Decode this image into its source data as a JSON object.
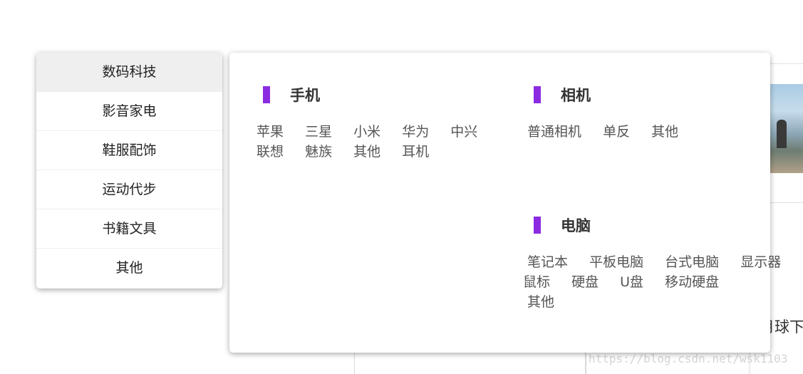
{
  "categories": [
    {
      "label": "数码科技",
      "active": true
    },
    {
      "label": "影音家电",
      "active": false
    },
    {
      "label": "鞋服配饰",
      "active": false
    },
    {
      "label": "运动代步",
      "active": false
    },
    {
      "label": "书籍文具",
      "active": false
    },
    {
      "label": "其他",
      "active": false
    }
  ],
  "panel": {
    "phone": {
      "title": "手机",
      "items": [
        "苹果",
        "三星",
        "小米",
        "华为",
        "中兴",
        "联想",
        "魅族",
        "其他",
        "耳机"
      ]
    },
    "camera": {
      "title": "相机",
      "items": [
        "普通相机",
        "单反",
        "其他"
      ]
    },
    "pc": {
      "title": "电脑",
      "items": [
        "笔记本",
        "平板电脑",
        "台式电脑",
        "显示器",
        "鼠标",
        "硬盘",
        "U盘",
        "移动硬盘",
        "其他"
      ]
    }
  },
  "background": {
    "title_fragment": "月球下",
    "watermark": "https://blog.csdn.net/wsk1103"
  },
  "colors": {
    "accent": "#8a2be2",
    "active_bg": "#efefef"
  }
}
